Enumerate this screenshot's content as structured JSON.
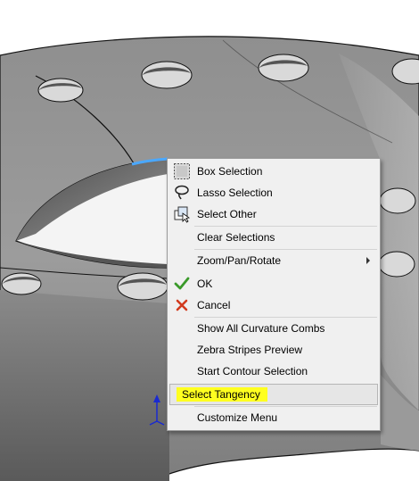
{
  "context_menu": {
    "items": [
      {
        "label": "Box Selection",
        "icon": "box-selection-icon"
      },
      {
        "label": "Lasso Selection",
        "icon": "lasso-icon"
      },
      {
        "label": "Select Other",
        "icon": "select-other-icon"
      },
      {
        "label": "Clear Selections"
      },
      {
        "label": "Zoom/Pan/Rotate",
        "has_submenu": true
      },
      {
        "label": "OK",
        "icon": "checkmark-icon",
        "icon_color": "#3a9a2a"
      },
      {
        "label": "Cancel",
        "icon": "close-icon",
        "icon_color": "#d23a1e"
      },
      {
        "label": "Show All Curvature Combs"
      },
      {
        "label": "Zebra Stripes Preview"
      },
      {
        "label": "Start Contour Selection"
      },
      {
        "label": "Select Tangency",
        "highlighted": true,
        "highlight_color": "#ffff20"
      },
      {
        "label": "Customize Menu"
      }
    ]
  },
  "viewport": {
    "selected_edge_color": "#4aa8ff",
    "triad_color": "#1a2ad0"
  }
}
